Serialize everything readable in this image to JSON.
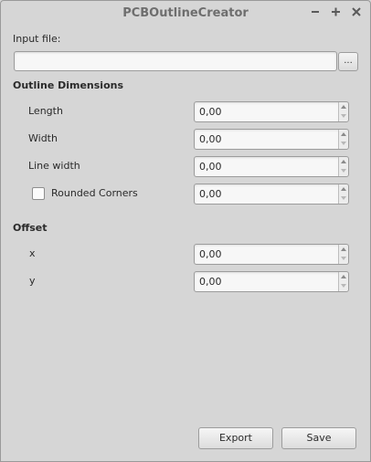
{
  "window": {
    "title": "PCBOutlineCreator",
    "controls": [
      "minimize-icon",
      "maximize-icon",
      "close-icon"
    ]
  },
  "input_file": {
    "label": "Input file:",
    "value": "",
    "browse_label": "..."
  },
  "outline": {
    "heading": "Outline Dimensions",
    "length": {
      "label": "Length",
      "value": "0,00"
    },
    "width": {
      "label": "Width",
      "value": "0,00"
    },
    "line_width": {
      "label": "Line width",
      "value": "0,00"
    },
    "rounded_corners": {
      "label": "Rounded Corners",
      "checked": false,
      "value": "0,00"
    }
  },
  "offset": {
    "heading": "Offset",
    "x": {
      "label": "x",
      "value": "0,00"
    },
    "y": {
      "label": "y",
      "value": "0,00"
    }
  },
  "buttons": {
    "export": "Export",
    "save": "Save"
  },
  "colors": {
    "background": "#d6d6d6",
    "title_text": "#6e6e6e",
    "field_background": "#f7f7f7",
    "border": "#9c9c9c"
  }
}
